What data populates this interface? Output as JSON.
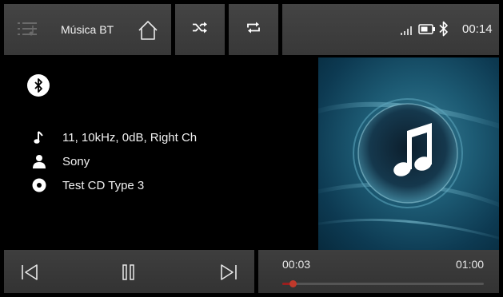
{
  "header": {
    "app_title": "Música BT",
    "clock": "00:14",
    "icons": [
      "menu-icon",
      "home-icon",
      "shuffle-icon",
      "repeat-icon",
      "signal-icon",
      "battery-icon",
      "bluetooth-icon"
    ]
  },
  "track": {
    "title": "11, 10kHz, 0dB, Right Ch",
    "artist": "Sony",
    "album": "Test CD Type 3"
  },
  "playback": {
    "elapsed": "00:03",
    "duration": "01:00",
    "progress": 0.05,
    "state": "paused"
  },
  "colors": {
    "bar": "#3b3b3b",
    "background": "#000000",
    "progress_accent": "#c0392b",
    "art_blue": "#1d5b74"
  }
}
